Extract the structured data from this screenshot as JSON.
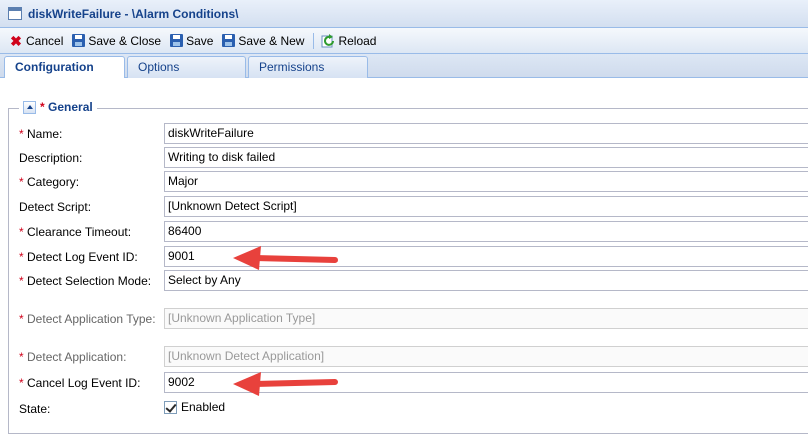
{
  "window": {
    "title": "diskWriteFailure - \\Alarm Conditions\\"
  },
  "toolbar": {
    "cancel": "Cancel",
    "save_close": "Save & Close",
    "save": "Save",
    "save_new": "Save & New",
    "reload": "Reload"
  },
  "tabs": [
    "Configuration",
    "Options",
    "Permissions"
  ],
  "section": {
    "required_mark": "*",
    "title": "General"
  },
  "fields": [
    {
      "required": true,
      "label": "Name:",
      "value": "diskWriteFailure"
    },
    {
      "required": false,
      "label": "Description:",
      "value": "Writing to disk failed"
    },
    {
      "required": true,
      "label": "Category:",
      "value": "Major"
    },
    {
      "required": false,
      "label": "Detect Script:",
      "value": "[Unknown Detect Script]"
    },
    {
      "required": true,
      "label": "Clearance Timeout:",
      "value": "86400"
    },
    {
      "required": true,
      "label": "Detect Log Event ID:",
      "value": "9001"
    },
    {
      "required": true,
      "label": "Detect Selection Mode:",
      "value": "Select by Any"
    },
    {
      "required": true,
      "label": "Detect Application Type:",
      "value": "[Unknown Application Type]",
      "disabled": true
    },
    {
      "required": true,
      "label": "Detect Application:",
      "value": "[Unknown Detect Application]",
      "disabled": true
    },
    {
      "required": true,
      "label": "Cancel Log Event ID:",
      "value": "9002"
    }
  ],
  "state": {
    "label": "State:",
    "checkbox_label": "Enabled",
    "checked": true
  },
  "colors": {
    "arrow": "#e8413c",
    "accent": "#15428b",
    "required": "#d0021b"
  }
}
